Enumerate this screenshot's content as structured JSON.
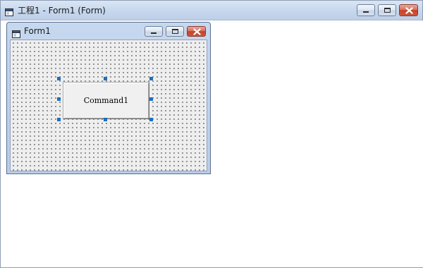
{
  "outer_window": {
    "title": "工程1 - Form1 (Form)",
    "icon": "form-window-icon",
    "controls": [
      "minimize-icon",
      "maximize-icon",
      "close-icon"
    ]
  },
  "form_window": {
    "title": "Form1",
    "icon": "form-window-icon",
    "controls": [
      "minimize-icon",
      "maximize-icon",
      "close-icon"
    ],
    "grid": "dotted"
  },
  "command_button": {
    "caption": "Command1",
    "selected": true
  },
  "colors": {
    "selection_handle": "#1f6ec0",
    "close_button": "#c5432a",
    "titlebar": "#c9d9ee"
  }
}
